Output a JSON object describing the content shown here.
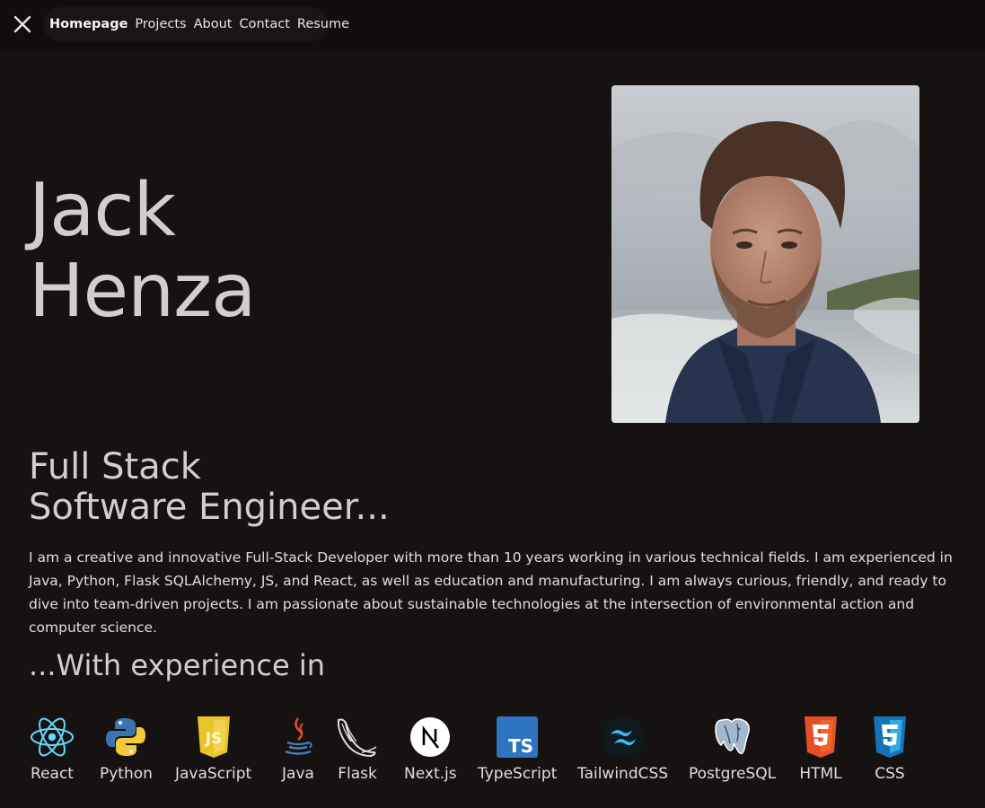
{
  "nav": {
    "links": [
      "Homepage",
      "Projects",
      "About",
      "Contact",
      "Resume"
    ]
  },
  "hero": {
    "first_name": "Jack",
    "last_name": "Henza",
    "subtitle_line1": "Full Stack",
    "subtitle_line2": "Software Engineer...",
    "bio": "I am a creative and innovative Full-Stack Developer with more than 10 years working in various technical fields. I am experienced in Java, Python, Flask SQLAlchemy, JS, and React, as well as education and manufacturing. I am always curious, friendly, and ready to dive into team-driven projects. I am passionate about sustainable technologies at the intersection of environmental action and computer science."
  },
  "experience": {
    "heading": "...With experience in",
    "skills": [
      {
        "label": "React",
        "icon": "react-icon"
      },
      {
        "label": "Python",
        "icon": "python-icon"
      },
      {
        "label": "JavaScript",
        "icon": "javascript-icon"
      },
      {
        "label": "Java",
        "icon": "java-icon"
      },
      {
        "label": "Flask",
        "icon": "flask-icon"
      },
      {
        "label": "Next.js",
        "icon": "nextjs-icon"
      },
      {
        "label": "TypeScript",
        "icon": "typescript-icon"
      },
      {
        "label": "TailwindCSS",
        "icon": "tailwindcss-icon"
      },
      {
        "label": "PostgreSQL",
        "icon": "postgresql-icon"
      },
      {
        "label": "HTML",
        "icon": "html5-icon"
      },
      {
        "label": "CSS",
        "icon": "css3-icon"
      }
    ]
  },
  "colors": {
    "background": "#161211",
    "navbar": "#100d0c",
    "text": "#d1cfcd"
  }
}
